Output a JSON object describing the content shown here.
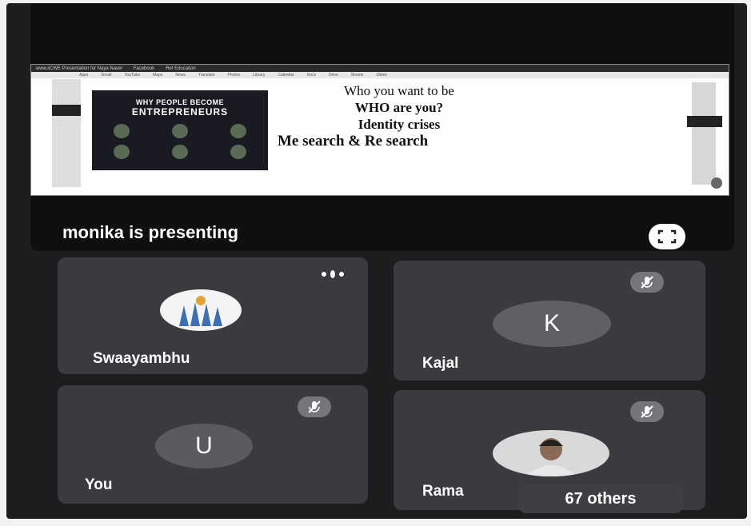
{
  "shared_screen": {
    "browser_tab": "www.iiCWE Presentation for Naya Navel",
    "browser_tabs2": "Facebook",
    "browser_tab3": "Ref Education",
    "bookmarks": [
      "Apps",
      "Gmail",
      "YouTube",
      "Maps",
      "News",
      "Translate",
      "Photos",
      "Library",
      "Calendar",
      "Docs",
      "Drive",
      "Sheets",
      "Slides"
    ],
    "poster_title_1": "WHY PEOPLE BECOME",
    "poster_title_2": "ENTREPRENEURS",
    "slide_line_1": "Who you want to be",
    "slide_line_2": "WHO are you?",
    "slide_line_3": "Identity crises",
    "slide_line_4": "Me search & Re search"
  },
  "presenting_label": "monika is presenting",
  "participants": [
    {
      "name": "Swaayambhu",
      "avatar": "hands-photo",
      "status": "speaking"
    },
    {
      "name": "Kajal",
      "initial": "K",
      "status": "muted",
      "avatar_color": "#5f6066"
    },
    {
      "name": "You",
      "initial": "U",
      "status": "muted",
      "avatar_color": "#5a5b60"
    },
    {
      "name": "Rama",
      "avatar": "person-photo",
      "status": "muted"
    }
  ],
  "others_label": "67 others",
  "icons": {
    "fullscreen": "fullscreen-icon",
    "mute": "mic-off-icon",
    "speaking": "audio-level-icon"
  }
}
